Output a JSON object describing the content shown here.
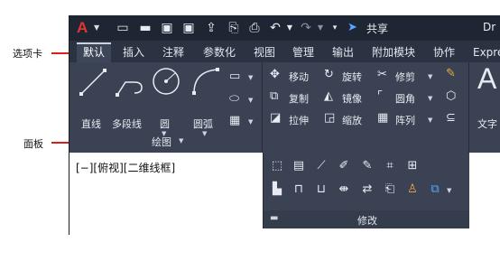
{
  "callouts": {
    "tabs_label": "选项卡",
    "panel_label": "面板"
  },
  "titlebar": {
    "share_label": "共享",
    "doc_title": "Dr"
  },
  "tabs": [
    {
      "label": "默认",
      "active": true
    },
    {
      "label": "插入"
    },
    {
      "label": "注释"
    },
    {
      "label": "参数化"
    },
    {
      "label": "视图"
    },
    {
      "label": "管理"
    },
    {
      "label": "输出"
    },
    {
      "label": "附加模块"
    },
    {
      "label": "协作"
    },
    {
      "label": "Expre"
    }
  ],
  "draw_panel": {
    "title": "绘图",
    "tools": [
      "直线",
      "多段线",
      "圆",
      "圆弧"
    ]
  },
  "modify_panel": {
    "title": "修改",
    "tools": [
      "移动",
      "旋转",
      "修剪",
      "复制",
      "镜像",
      "圆角",
      "拉伸",
      "缩放",
      "阵列"
    ]
  },
  "text_panel": {
    "label": "文字"
  },
  "viewport": {
    "label": "[−][俯视][二维线框]"
  },
  "colors": {
    "accent_red": "#d62020",
    "ribbon_bg": "#3a4253",
    "titlebar_bg": "#1f2633",
    "share_blue": "#58a6ff"
  }
}
